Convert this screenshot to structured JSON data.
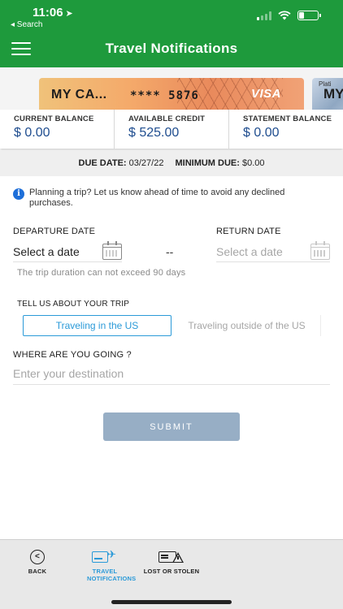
{
  "status_bar": {
    "time": "11:06",
    "back_app": "◂ Search"
  },
  "header": {
    "title": "Travel Notifications"
  },
  "cards": {
    "primary": {
      "name": "MY CA...",
      "number": "**** 5876",
      "network": "VISA",
      "gradient_colors": [
        "#f0c27a",
        "#e98a5c"
      ]
    },
    "secondary": {
      "small_text": "Plati",
      "big_text": "MY"
    }
  },
  "balances": {
    "current": {
      "label": "CURRENT BALANCE",
      "value": "$ 0.00"
    },
    "available": {
      "label": "AVAILABLE CREDIT",
      "value": "$ 525.00"
    },
    "statement": {
      "label": "STATEMENT BALANCE",
      "value": "$ 0.00"
    }
  },
  "due": {
    "due_label": "DUE DATE:",
    "due_value": "03/27/22",
    "min_label": "MINIMUM DUE:",
    "min_value": "$0.00"
  },
  "info": {
    "text": "Planning a trip? Let us know ahead of time to avoid any declined purchases."
  },
  "dates": {
    "departure_label": "DEPARTURE DATE",
    "departure_placeholder": "Select a date",
    "separator": "--",
    "return_label": "RETURN DATE",
    "return_placeholder": "Select a date",
    "hint": "The trip duration can not exceed 90 days"
  },
  "trip": {
    "label": "TELL US ABOUT YOUR TRIP",
    "options": [
      {
        "label": "Traveling in the US",
        "selected": true
      },
      {
        "label": "Traveling outside of the US",
        "selected": false
      }
    ]
  },
  "destination": {
    "label": "WHERE ARE YOU GOING ?",
    "placeholder": "Enter your destination",
    "value": ""
  },
  "submit": {
    "label": "SUBMIT"
  },
  "bottom_nav": {
    "items": [
      {
        "label": "BACK",
        "icon": "back-circle-icon",
        "active": false
      },
      {
        "label": "TRAVEL NOTIFICATIONS",
        "icon": "card-plane-icon",
        "active": true
      },
      {
        "label": "LOST OR STOLEN",
        "icon": "card-warning-icon",
        "active": false
      }
    ]
  },
  "colors": {
    "brand_green": "#1e9a3c",
    "accent_blue": "#2b9ad8",
    "balance_blue": "#1f4d8f",
    "submit_disabled": "#97aec5"
  }
}
